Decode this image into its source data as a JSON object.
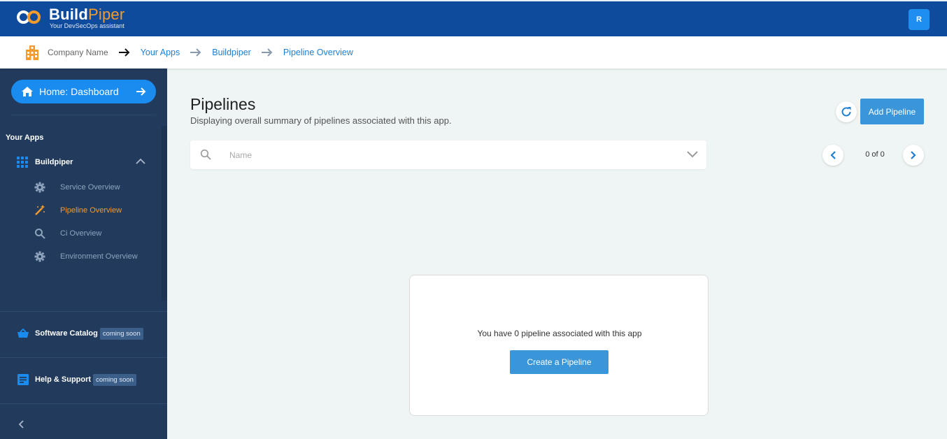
{
  "header": {
    "logo_name": "Build",
    "logo_name_accent": "Piper",
    "logo_tagline": "Your DevSecOps assistant",
    "avatar_initial": "R",
    "brand_color": "#0f4b9d",
    "accent_color": "#f49b2c"
  },
  "breadcrumb": {
    "company": "Company Name",
    "items": [
      "Your Apps",
      "Buildpiper",
      "Pipeline Overview"
    ]
  },
  "sidebar": {
    "home_button": "Home: Dashboard",
    "section_label": "Your Apps",
    "app_name": "Buildpiper",
    "sub_items": [
      {
        "label": "Service Overview",
        "icon": "gear-icon",
        "active": false
      },
      {
        "label": "Pipeline Overview",
        "icon": "magic-wand-icon",
        "active": true
      },
      {
        "label": "Ci Overview",
        "icon": "search-icon",
        "active": false
      },
      {
        "label": "Environment Overview",
        "icon": "gear-icon",
        "active": false
      }
    ],
    "bottom_items": [
      {
        "label": "Software Catalog",
        "badge": "coming soon",
        "icon": "basket-icon"
      },
      {
        "label": "Help & Support",
        "badge": "coming soon",
        "icon": "document-icon"
      }
    ]
  },
  "main": {
    "title": "Pipelines",
    "subtitle": "Displaying overall summary of pipelines associated with this app.",
    "add_button": "Add Pipeline",
    "search_placeholder": "Name",
    "pagination": "0 of 0",
    "empty_message": "You have 0 pipeline associated with this app",
    "create_button": "Create a Pipeline"
  }
}
